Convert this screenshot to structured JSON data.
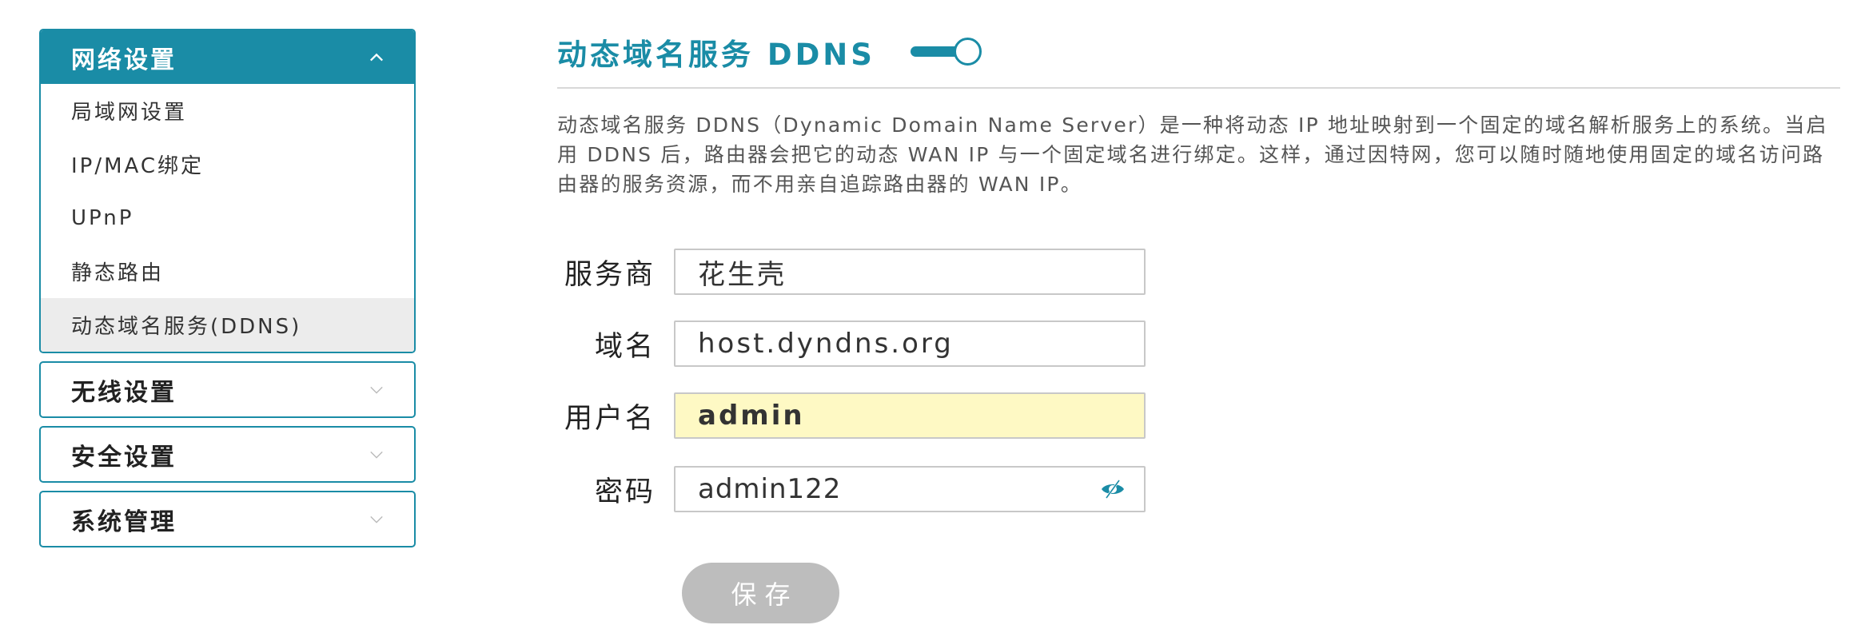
{
  "sidebar": {
    "groups": [
      {
        "label": "网络设置",
        "expanded": true,
        "items": [
          {
            "label": "局域网设置"
          },
          {
            "label": "IP/MAC绑定"
          },
          {
            "label": "UPnP"
          },
          {
            "label": "静态路由"
          },
          {
            "label": "动态域名服务(DDNS)",
            "active": true
          }
        ]
      },
      {
        "label": "无线设置",
        "expanded": false
      },
      {
        "label": "安全设置",
        "expanded": false
      },
      {
        "label": "系统管理",
        "expanded": false
      }
    ]
  },
  "main": {
    "title": "动态域名服务 DDNS",
    "ddns_enabled": true,
    "description": "动态域名服务 DDNS（Dynamic Domain Name Server）是一种将动态 IP 地址映射到一个固定的域名解析服务上的系统。当启用 DDNS 后，路由器会把它的动态 WAN IP 与一个固定域名进行绑定。这样，通过因特网，您可以随时随地使用固定的域名访问路由器的服务资源，而不用亲自追踪路由器的 WAN IP。",
    "form": {
      "provider_label": "服务商",
      "provider_value": "花生壳",
      "domain_label": "域名",
      "domain_value": "host.dyndns.org",
      "username_label": "用户名",
      "username_value": "admin",
      "password_label": "密码",
      "password_value": "admin122"
    },
    "save_label": "保存"
  },
  "colors": {
    "accent": "#1a8ca6",
    "active_item_bg": "#ececec",
    "autofill_bg": "#fef9c4",
    "disabled_button": "#bdbdbd"
  },
  "icons": {
    "expanded": "chevron-up-icon",
    "collapsed": "chevron-down-icon",
    "password_toggle": "eye-slash-icon"
  }
}
